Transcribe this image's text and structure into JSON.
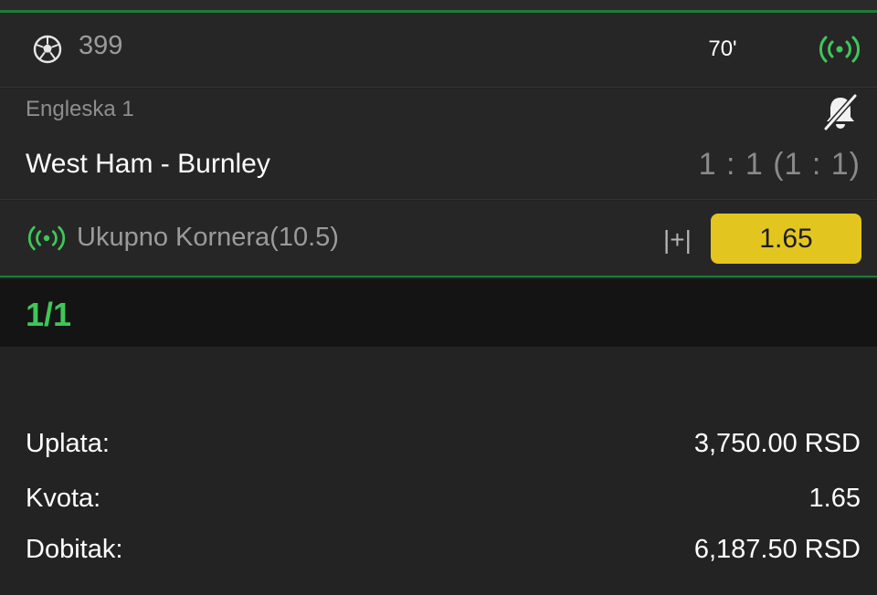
{
  "event": {
    "code": "399",
    "minute": "70'",
    "sport_icon": "soccer-ball-icon",
    "live_icon": "live-broadcast-icon"
  },
  "match": {
    "league": "Engleska 1",
    "teams": "West Ham - Burnley",
    "score": "1 : 1 (1 : 1)",
    "notification_icon": "bell-off-icon"
  },
  "pick": {
    "name": "Ukupno Kornera(10.5)",
    "sign": "|+|",
    "odds": "1.65",
    "live_icon": "live-broadcast-icon"
  },
  "ticket": {
    "count": "1/1"
  },
  "summary": {
    "stake_label": "Uplata:",
    "stake_value": "3,750.00 RSD",
    "odds_label": "Kvota:",
    "odds_value": "1.65",
    "win_label": "Dobitak:",
    "win_value": "6,187.50 RSD"
  },
  "colors": {
    "accent_green": "#3ec75a",
    "odds_yellow": "#e3c520",
    "background": "#232323"
  }
}
